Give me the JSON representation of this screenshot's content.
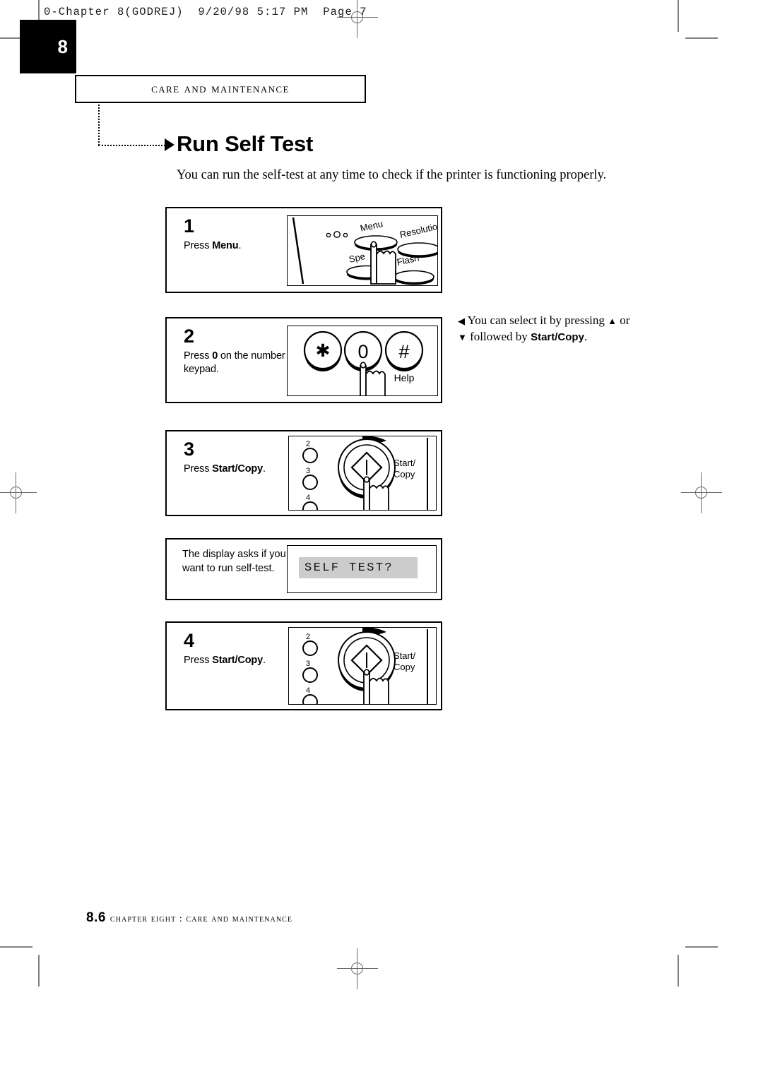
{
  "file_header": "0-Chapter 8(GODREJ)  9/20/98 5:17 PM  Page 7",
  "chapter_tab": "8",
  "running_head": "Care and Maintenance",
  "page_title": "Run Self Test",
  "intro": "You can run the self-test at any time to check if the printer is functioning properly.",
  "steps": [
    {
      "number": "1",
      "text_before": "Press ",
      "text_bold": "Menu",
      "text_after": ".",
      "panel_labels": [
        "Menu",
        "Resolution",
        "Spe",
        "Flash"
      ]
    },
    {
      "number": "2",
      "text_before": "Press ",
      "text_bold": "0",
      "text_after": " on the number keypad.",
      "panel_labels": [
        "*",
        "0",
        "#",
        "Help"
      ]
    },
    {
      "number": "3",
      "text_before": "Press ",
      "text_bold": "Start/Copy",
      "text_after": ".",
      "panel_labels": [
        "2",
        "3",
        "4",
        "Start/",
        "Copy"
      ]
    },
    {
      "number": "4",
      "text_before": "Press ",
      "text_bold": "Start/Copy",
      "text_after": ".",
      "panel_labels": [
        "2",
        "3",
        "4",
        "Start/",
        "Copy"
      ]
    }
  ],
  "sidenote": {
    "left_arrow": "◀",
    "line1_a": " You can select it by pressing ",
    "up_arrow": "▲",
    "line1_b": " or",
    "down_arrow": "▼",
    "line2_a": " followed by ",
    "line2_bold": "Start/Copy",
    "line2_b": "."
  },
  "lcd": {
    "caption": "The display asks if you want to run self-test.",
    "screen_text": "SELF TEST?",
    "screen_color": "#cccccc"
  },
  "footer": {
    "page_number": "8.6",
    "text": "Chapter Eight : Care and Maintenance"
  }
}
